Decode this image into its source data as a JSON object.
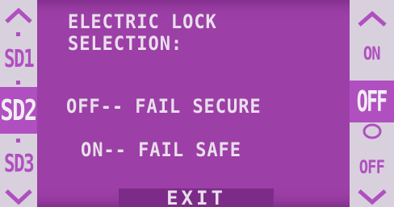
{
  "left_panel": {
    "up_icon": "chevron-up",
    "items": [
      {
        "label": "SD1",
        "selected": false
      },
      {
        "label": "SD2",
        "selected": true
      },
      {
        "label": "SD3",
        "selected": false
      }
    ],
    "down_icon": "chevron-down"
  },
  "main": {
    "title_line1": "ELECTRIC LOCK",
    "title_line2": "SELECTION:",
    "option_off": "OFF-- FAIL SECURE",
    "option_on": "ON-- FAIL SAFE",
    "exit_label": "EXIT"
  },
  "right_panel": {
    "up_icon": "chevron-up",
    "on_label": "ON",
    "current_value": "OFF",
    "indicator_icon": "circle",
    "off_label": "OFF",
    "down_icon": "chevron-down"
  },
  "colors": {
    "screen_bg": "#9c3fa6",
    "key_bg": "#d8d0dd",
    "key_fg": "#b04fc0",
    "text": "#e9dfec",
    "exit_bar": "#7c2c88"
  }
}
